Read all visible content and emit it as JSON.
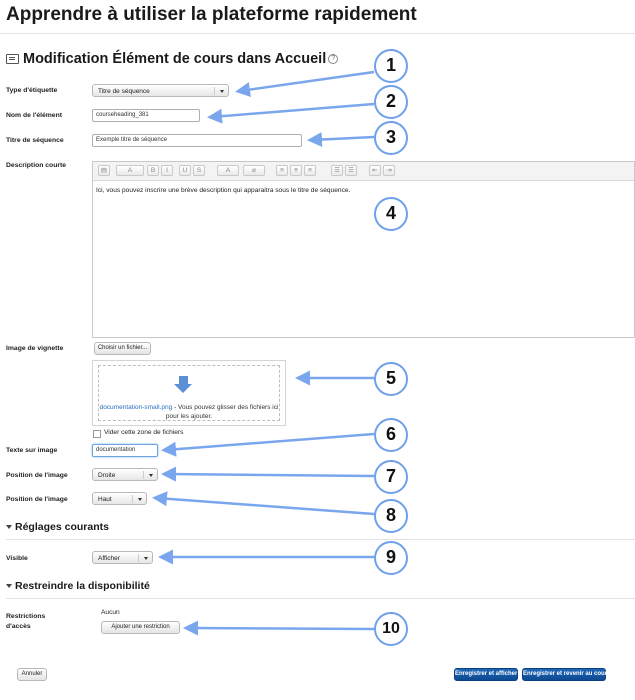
{
  "page": {
    "title": "Apprendre à utiliser la plateforme rapidement"
  },
  "section": {
    "title": "Modification Élément de cours dans Accueil",
    "help_glyph": "?"
  },
  "fields": {
    "type_label": "Type d'étiquette",
    "type_value": "Titre de séquence",
    "name_label": "Nom de l'élément",
    "name_value": "courseheading_381",
    "seq_title_label": "Titre de séquence",
    "seq_title_value": "Exemple titre de séquence",
    "desc_label": "Description courte",
    "desc_value": "Ici, vous pouvez inscrire une brève description qui apparaitra sous le titre de séquence.",
    "image_label": "Image de vignette",
    "choose_file_label": "Choisir un fichier...",
    "dropzone_file": "documentation-small.png",
    "dropzone_text": " - Vous pouvez glisser des fichiers ici pour les ajouter.",
    "clear_label": "Vider cette zone de fichiers",
    "img_text_label": "Texte sur image",
    "img_text_value": "documentation",
    "img_pos_label": "Position de l'image",
    "img_pos_value": "Droite",
    "img_pos2_label": "Position de l'image",
    "img_pos2_value": "Haut"
  },
  "editor_toolbar": [
    "▤",
    "A",
    "B",
    "I",
    "U",
    "S",
    "A",
    "⌀",
    "≡",
    "≡",
    "≡",
    "☰",
    "☰",
    "⇤",
    "⇥"
  ],
  "common": {
    "title": "Réglages courants",
    "visible_label": "Visible",
    "visible_value": "Afficher"
  },
  "restrict": {
    "title": "Restreindre la disponibilité",
    "label_line1": "Restrictions",
    "label_line2": "d'accès",
    "none_text": "Aucun",
    "add_button": "Ajouter une restriction"
  },
  "footer": {
    "cancel": "Annuler",
    "save_display": "Enregistrer et afficher",
    "save_return": "Enregistrer et revenir au cours"
  },
  "callouts": [
    "1",
    "2",
    "3",
    "4",
    "5",
    "6",
    "7",
    "8",
    "9",
    "10"
  ],
  "colors": {
    "callout_border": "#6fa0ea",
    "arrow": "#7aa6ee",
    "primary": "#0d4a92"
  }
}
